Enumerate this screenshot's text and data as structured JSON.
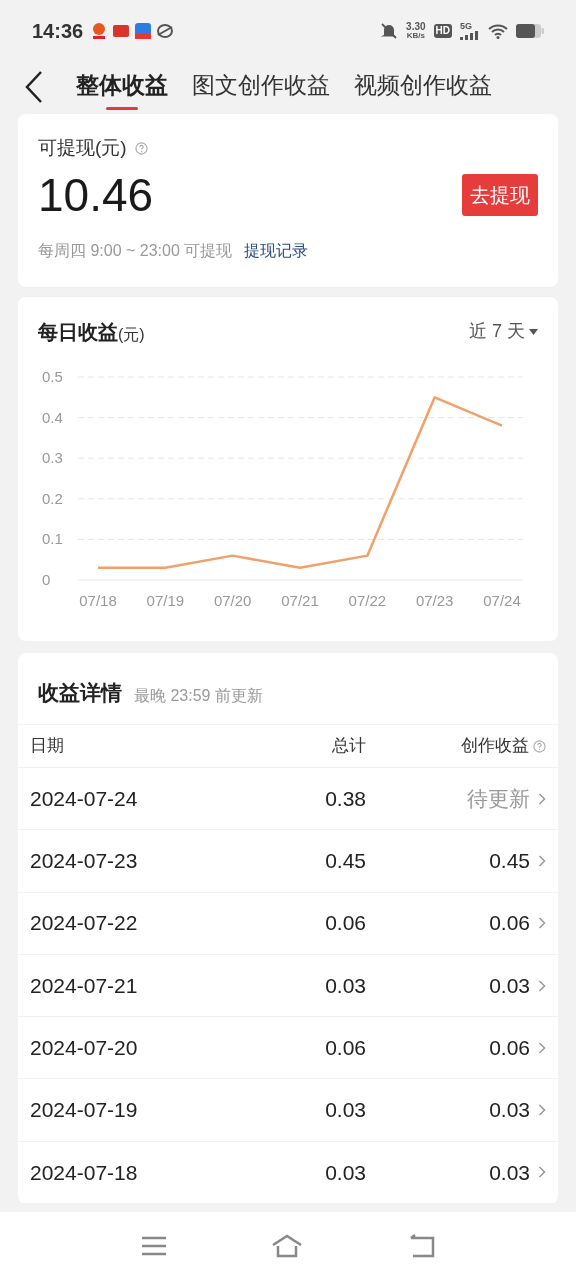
{
  "status_bar": {
    "time": "14:36",
    "net_speed": "3.30",
    "net_unit": "KB/s",
    "hd": "HD",
    "network": "5G"
  },
  "tabs": [
    {
      "label": "整体收益",
      "selected": true
    },
    {
      "label": "图文创作收益",
      "selected": false
    },
    {
      "label": "视频创作收益",
      "selected": false
    }
  ],
  "balance": {
    "label": "可提现(元)",
    "amount": "10.46",
    "button": "去提现",
    "note": "每周四 9:00 ~ 23:00 可提现",
    "link": "提现记录"
  },
  "daily": {
    "title": "每日收益",
    "unit": "(元)",
    "range": "近 7 天",
    "chart_data": {
      "type": "line",
      "categories": [
        "07/18",
        "07/19",
        "07/20",
        "07/21",
        "07/22",
        "07/23",
        "07/24"
      ],
      "grid": true,
      "series": [
        {
          "color": "#f0a06a",
          "values": [
            0.03,
            0.03,
            0.06,
            0.03,
            0.06,
            0.45,
            0.38
          ]
        }
      ],
      "ylim": [
        0,
        0.5
      ],
      "yticks": [
        {
          "value": 0,
          "label": "0"
        },
        {
          "value": 0.1,
          "label": "0.1"
        },
        {
          "value": 0.2,
          "label": "0.2"
        },
        {
          "value": 0.3,
          "label": "0.3"
        },
        {
          "value": 0.4,
          "label": "0.4"
        },
        {
          "value": 0.5,
          "label": "0.5"
        }
      ]
    }
  },
  "details": {
    "title": "收益详情",
    "subtitle": "最晚 23:59 前更新",
    "columns": [
      "日期",
      "总计",
      "创作收益"
    ],
    "rows": [
      {
        "date": "2024-07-24",
        "total": "0.38",
        "creation": "待更新",
        "kind": "pending"
      },
      {
        "date": "2024-07-23",
        "total": "0.45",
        "creation": "0.45",
        "kind": "value"
      },
      {
        "date": "2024-07-22",
        "total": "0.06",
        "creation": "0.06",
        "kind": "value"
      },
      {
        "date": "2024-07-21",
        "total": "0.03",
        "creation": "0.03",
        "kind": "value"
      },
      {
        "date": "2024-07-20",
        "total": "0.06",
        "creation": "0.06",
        "kind": "value"
      },
      {
        "date": "2024-07-19",
        "total": "0.03",
        "creation": "0.03",
        "kind": "value"
      },
      {
        "date": "2024-07-18",
        "total": "0.03",
        "creation": "0.03",
        "kind": "value"
      }
    ]
  }
}
